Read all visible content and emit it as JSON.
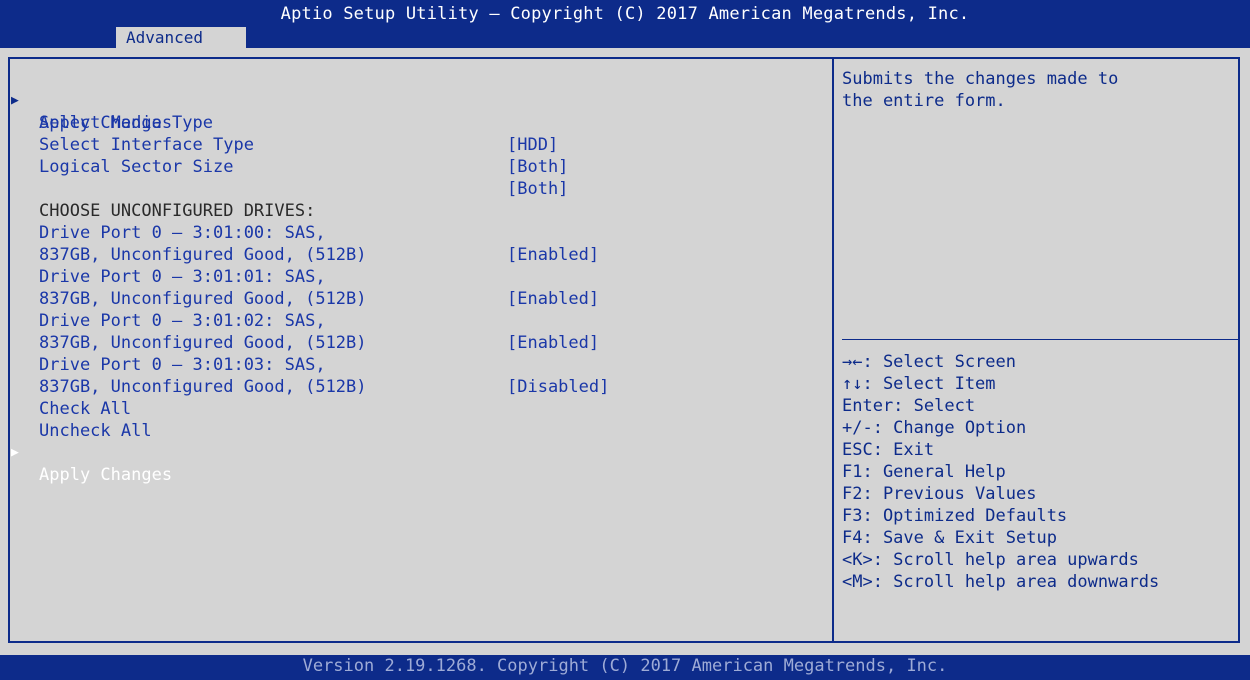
{
  "header": {
    "title": "Aptio Setup Utility – Copyright (C) 2017 American Megatrends, Inc.",
    "tab": "Advanced"
  },
  "menu": {
    "apply_top": "Apply Changes",
    "media": {
      "label": "Select Media Type",
      "value": "[HDD]"
    },
    "interface": {
      "label": "Select Interface Type",
      "value": "[Both]"
    },
    "sector": {
      "label": "Logical Sector Size",
      "value": "[Both]"
    },
    "section_heading": "CHOOSE UNCONFIGURED DRIVES:",
    "drives": [
      {
        "line1": "Drive Port 0 – 3:01:00: SAS,",
        "line2": "837GB, Unconfigured Good, (512B)",
        "value": "[Enabled]"
      },
      {
        "line1": "Drive Port 0 – 3:01:01: SAS,",
        "line2": "837GB, Unconfigured Good, (512B)",
        "value": "[Enabled]"
      },
      {
        "line1": "Drive Port 0 – 3:01:02: SAS,",
        "line2": "837GB, Unconfigured Good, (512B)",
        "value": "[Enabled]"
      },
      {
        "line1": "Drive Port 0 – 3:01:03: SAS,",
        "line2": "837GB, Unconfigured Good, (512B)",
        "value": "[Disabled]"
      }
    ],
    "check_all": "Check All",
    "uncheck_all": "Uncheck All",
    "apply_bottom": "Apply Changes"
  },
  "help": {
    "description": [
      "Submits the changes made to",
      "the entire form."
    ],
    "keys": [
      "→←: Select Screen",
      "↑↓: Select Item",
      "Enter: Select",
      "+/-: Change Option",
      "ESC: Exit",
      "F1: General Help",
      "F2: Previous Values",
      "F3: Optimized Defaults",
      "F4: Save & Exit Setup",
      "<K>: Scroll help area upwards",
      "<M>: Scroll help area downwards"
    ]
  },
  "footer": {
    "version": "Version 2.19.1268. Copyright (C) 2017 American Megatrends, Inc."
  },
  "colors": {
    "bar_blue": "#0d2b8a",
    "item_blue": "#1a37a8",
    "background_gray": "#d4d4d4",
    "selected_white": "#ffffff"
  },
  "icons": {
    "submenu_marker": "triangle-right-icon"
  }
}
